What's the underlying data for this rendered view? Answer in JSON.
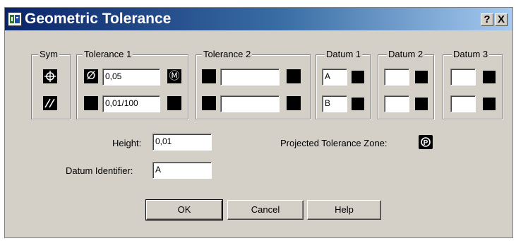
{
  "window": {
    "title": "Geometric Tolerance",
    "help_glyph": "?",
    "close_glyph": "X"
  },
  "groups": {
    "sym": "Sym",
    "tolerance1": "Tolerance 1",
    "tolerance2": "Tolerance 2",
    "datum1": "Datum 1",
    "datum2": "Datum 2",
    "datum3": "Datum 3"
  },
  "symbols": {
    "row1": "position-icon",
    "row2": "parallelism-icon"
  },
  "tolerance1": {
    "row1": {
      "diameter": "Ø",
      "value": "0,05",
      "material_condition": "Ⓜ"
    },
    "row2": {
      "value": "0,01/100"
    }
  },
  "datum1": {
    "row1": "A",
    "row2": "B"
  },
  "height": {
    "label": "Height:",
    "value": "0,01"
  },
  "projected_zone": {
    "label": "Projected Tolerance Zone:"
  },
  "datum_identifier": {
    "label": "Datum Identifier:",
    "value": "A"
  },
  "buttons": {
    "ok": "OK",
    "cancel": "Cancel",
    "help": "Help"
  },
  "colors": {
    "title_start": "#0a246a",
    "title_end": "#a6caf0",
    "face": "#d4d0c8"
  }
}
